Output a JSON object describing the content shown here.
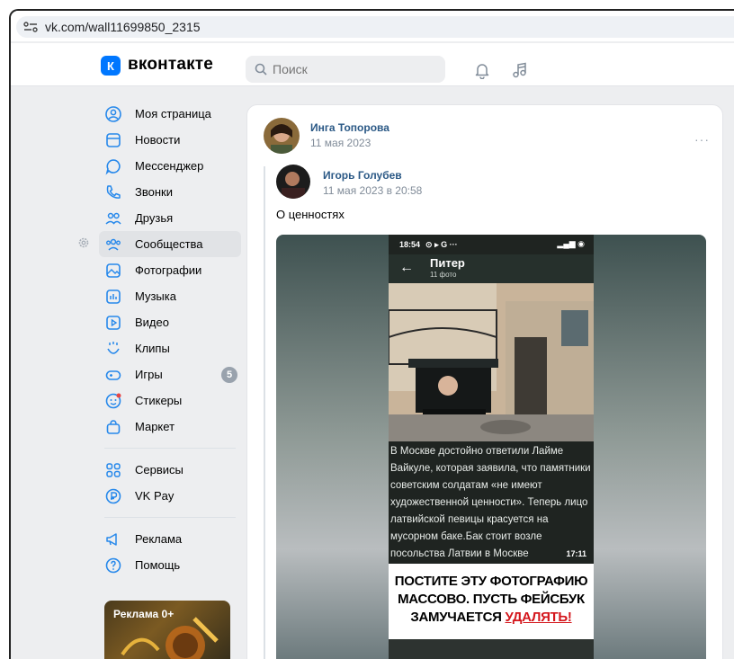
{
  "browser": {
    "url": "vk.com/wall11699850_2315"
  },
  "header": {
    "brand": "вконтакте",
    "logo_letter": "К",
    "search_placeholder": "Поиск",
    "brand_color": "#0077ff"
  },
  "sidebar": {
    "items": [
      {
        "label": "Моя страница",
        "icon": "user-circle-icon"
      },
      {
        "label": "Новости",
        "icon": "newspaper-icon"
      },
      {
        "label": "Мессенджер",
        "icon": "chat-bubble-icon"
      },
      {
        "label": "Звонки",
        "icon": "phone-icon"
      },
      {
        "label": "Друзья",
        "icon": "friends-icon"
      },
      {
        "label": "Сообщества",
        "icon": "communities-icon"
      },
      {
        "label": "Фотографии",
        "icon": "photos-icon"
      },
      {
        "label": "Музыка",
        "icon": "music-icon"
      },
      {
        "label": "Видео",
        "icon": "video-icon"
      },
      {
        "label": "Клипы",
        "icon": "clips-icon"
      },
      {
        "label": "Игры",
        "icon": "gamepad-icon",
        "badge": "5"
      },
      {
        "label": "Стикеры",
        "icon": "sticker-icon"
      },
      {
        "label": "Маркет",
        "icon": "shopping-bag-icon"
      }
    ],
    "items2": [
      {
        "label": "Сервисы",
        "icon": "services-icon"
      },
      {
        "label": "VK Pay",
        "icon": "vkpay-icon"
      }
    ],
    "items3": [
      {
        "label": "Реклама",
        "icon": "megaphone-icon"
      },
      {
        "label": "Помощь",
        "icon": "help-icon"
      }
    ],
    "ad_label": "Реклама 0+"
  },
  "post": {
    "author": "Инга Топорова",
    "date": "11 мая 2023",
    "repost_author": "Игорь Голубев",
    "repost_date": "11 мая 2023 в 20:58",
    "text": "О ценностях",
    "more": "···"
  },
  "media": {
    "status_time": "18:54",
    "status_extra": "⊙ ▸ G ···",
    "album_title": "Питер",
    "album_count": "11 фото",
    "caption": "В Москве достойно ответили Лайме Вайкуле, которая заявила, что памятники советским солдатам «не имеют художественной ценности». Теперь лицо латвийской певицы красуется на мусорном баке.Бак стоит возле посольства Латвии в Москве",
    "caption_time": "17:11",
    "banner_line1": "ПОСТИТЕ ЭТУ ФОТОГРАФИЮ",
    "banner_line2": "МАССОВО. ПУСТЬ ФЕЙСБУК",
    "banner_line3a": "ЗАМУЧАЕТСЯ ",
    "banner_line3b": "УДАЛЯТЬ!"
  }
}
